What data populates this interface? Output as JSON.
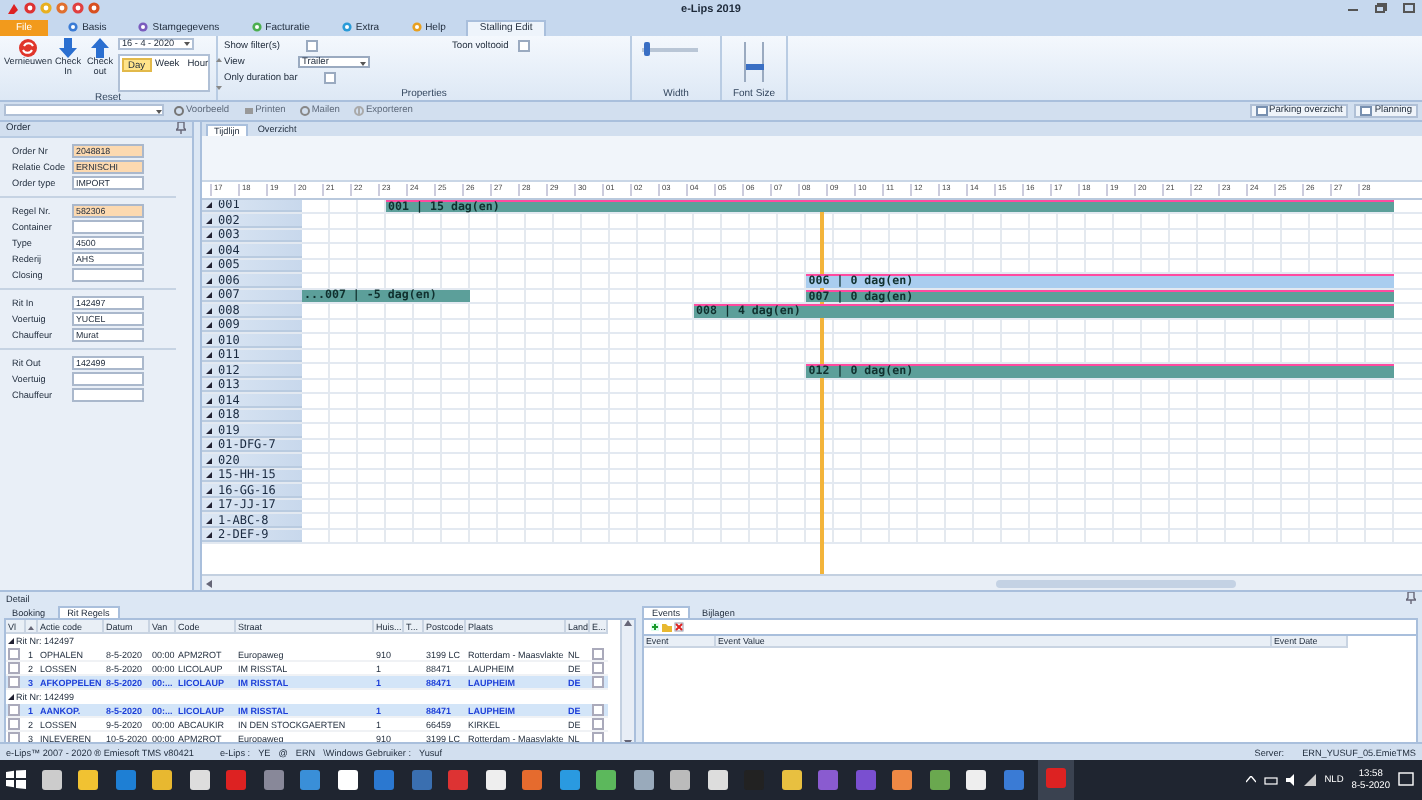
{
  "window": {
    "title": "e-Lips 2019"
  },
  "ribbon": {
    "tabs": [
      {
        "label": "File",
        "kind": "file",
        "selected": false
      },
      {
        "label": "Basis",
        "kind": "page",
        "selected": false
      },
      {
        "label": "Stamgegevens",
        "kind": "page",
        "selected": false
      },
      {
        "label": "Facturatie",
        "kind": "page",
        "selected": false
      },
      {
        "label": "Extra",
        "kind": "page",
        "selected": false
      },
      {
        "label": "Help",
        "kind": "page",
        "selected": false
      },
      {
        "label": "Stalling Edit",
        "kind": "page",
        "selected": true
      }
    ],
    "reset_group": {
      "label": "Reset",
      "buttons": [
        "Vernieuwen",
        "Check In",
        "Check out"
      ],
      "date": "16 - 4 - 2020",
      "scales": [
        {
          "label": "Day",
          "selected": true
        },
        {
          "label": "Week",
          "selected": false
        },
        {
          "label": "Hour",
          "selected": false
        }
      ]
    },
    "properties_group": {
      "label": "Properties",
      "options": [
        {
          "kind": "checkbox",
          "label": "Show filter(s)",
          "checked": false
        },
        {
          "kind": "checkbox",
          "label": "Toon voltooid",
          "checked": false
        },
        {
          "kind": "dropdown",
          "label": "View",
          "value": "Trailer"
        },
        {
          "kind": "checkbox",
          "label": "Only duration bar",
          "checked": false
        }
      ]
    },
    "width_group": {
      "label": "Width",
      "level": 0.1
    },
    "font_size_group": {
      "label": "Font Size",
      "level": 0.35
    }
  },
  "toolbar": {
    "buttons": [
      {
        "label": "Voorbeeld",
        "disabled": true
      },
      {
        "label": "Printen",
        "disabled": true
      },
      {
        "label": "Mailen",
        "disabled": true
      },
      {
        "label": "Exporteren",
        "disabled": true
      }
    ],
    "right_buttons": [
      "Parking overzicht",
      "Planning"
    ]
  },
  "order_panel": {
    "title": "Order",
    "sections": [
      {
        "fields": [
          {
            "label": "Order Nr",
            "value": "2048818",
            "highlighted": true
          },
          {
            "label": "Relatie Code",
            "value": "ERNISCHI",
            "highlighted": true
          },
          {
            "label": "Order type",
            "value": "IMPORT",
            "highlighted": false
          }
        ]
      },
      {
        "fields": [
          {
            "label": "Regel Nr.",
            "value": "582306",
            "highlighted": true
          },
          {
            "label": "Container",
            "highlighted": false
          },
          {
            "label": "Type",
            "value": "4500",
            "highlighted": false
          },
          {
            "label": "Rederij",
            "value": "AHS",
            "highlighted": false
          },
          {
            "label": "Closing",
            "highlighted": false
          }
        ]
      },
      {
        "fields": [
          {
            "label": "Rit In",
            "value": "142497",
            "highlighted": false
          },
          {
            "label": "Voertuig",
            "value": "YUCEL",
            "highlighted": false
          },
          {
            "label": "Chauffeur",
            "value": "Murat",
            "highlighted": false
          }
        ]
      },
      {
        "fields": [
          {
            "label": "Rit Out",
            "value": "142499",
            "highlighted": false
          },
          {
            "label": "Voertuig",
            "highlighted": false
          },
          {
            "label": "Chauffeur",
            "highlighted": false
          }
        ]
      }
    ]
  },
  "timeline": {
    "tabs": [
      {
        "label": "Tijdlijn",
        "selected": true
      },
      {
        "label": "Overzicht",
        "selected": false
      }
    ],
    "ticks": [
      {
        "label": "17",
        "now": false
      },
      {
        "label": "18",
        "now": false
      },
      {
        "label": "19",
        "now": false
      },
      {
        "label": "20",
        "now": false
      },
      {
        "label": "21",
        "now": false
      },
      {
        "label": "22",
        "now": false
      },
      {
        "label": "23",
        "now": false
      },
      {
        "label": "24",
        "now": false
      },
      {
        "label": "25",
        "now": false
      },
      {
        "label": "26",
        "now": false
      },
      {
        "label": "27",
        "now": false
      },
      {
        "label": "28",
        "now": false
      },
      {
        "label": "29",
        "now": false
      },
      {
        "label": "30",
        "now": false
      },
      {
        "label": "01",
        "now": false
      },
      {
        "label": "02",
        "now": false
      },
      {
        "label": "03",
        "now": false
      },
      {
        "label": "04",
        "now": false
      },
      {
        "label": "05",
        "now": false
      },
      {
        "label": "06",
        "now": false
      },
      {
        "label": "07",
        "now": false
      },
      {
        "label": "08",
        "now": true
      },
      {
        "label": "09",
        "now": false
      },
      {
        "label": "10",
        "now": false
      },
      {
        "label": "11",
        "now": false
      },
      {
        "label": "12",
        "now": false
      },
      {
        "label": "13",
        "now": false
      },
      {
        "label": "14",
        "now": false
      },
      {
        "label": "15",
        "now": false
      },
      {
        "label": "16",
        "now": false
      },
      {
        "label": "17",
        "now": false
      },
      {
        "label": "18",
        "now": false
      },
      {
        "label": "19",
        "now": false
      },
      {
        "label": "20",
        "now": false
      },
      {
        "label": "21",
        "now": false
      },
      {
        "label": "22",
        "now": false
      },
      {
        "label": "23",
        "now": false
      },
      {
        "label": "24",
        "now": false
      },
      {
        "label": "25",
        "now": false
      },
      {
        "label": "26",
        "now": false
      },
      {
        "label": "27",
        "now": false
      },
      {
        "label": "28",
        "now": false
      }
    ],
    "rows": [
      {
        "label": "001",
        "bars": [
          {
            "label": "001 | 15 dag(en)",
            "kind": "outgoing",
            "level": 0.923,
            "flagged": true,
            "selected": false
          }
        ]
      },
      {
        "label": "002"
      },
      {
        "label": "003"
      },
      {
        "label": "004"
      },
      {
        "label": "005"
      },
      {
        "label": "006",
        "bars": [
          {
            "label": "006 | 0 dag(en)",
            "kind": "outgoing",
            "level": 0.538,
            "flagged": true,
            "selected": true
          }
        ]
      },
      {
        "label": "007",
        "bars": [
          {
            "label": "...007 | -5 dag(en)",
            "kind": "incoming",
            "level": 0.154,
            "flagged": false,
            "selected": false
          },
          {
            "label": "007 | 0 dag(en)",
            "kind": "outgoing",
            "level": 0.538,
            "flagged": true,
            "selected": false
          }
        ]
      },
      {
        "label": "008",
        "bars": [
          {
            "label": "008 | 4 dag(en)",
            "kind": "outgoing",
            "level": 0.641,
            "flagged": true,
            "selected": false
          }
        ]
      },
      {
        "label": "009"
      },
      {
        "label": "010"
      },
      {
        "label": "011"
      },
      {
        "label": "012",
        "bars": [
          {
            "label": "012 | 0 dag(en)",
            "kind": "outgoing",
            "level": 0.538,
            "flagged": true,
            "selected": false
          }
        ]
      },
      {
        "label": "013"
      },
      {
        "label": "014"
      },
      {
        "label": "018"
      },
      {
        "label": "019"
      },
      {
        "label": "01-DFG-7"
      },
      {
        "label": "020"
      },
      {
        "label": "15-HH-15"
      },
      {
        "label": "16-GG-16"
      },
      {
        "label": "17-JJ-17"
      },
      {
        "label": "1-ABC-8"
      },
      {
        "label": "2-DEF-9"
      }
    ]
  },
  "detail": {
    "title": "Detail",
    "tabs": [
      {
        "label": "Booking",
        "selected": false
      },
      {
        "label": "Rit Regels",
        "selected": true
      }
    ],
    "columns": [
      "Vl",
      "Actie code",
      "Datum",
      "Van",
      "Code",
      "Straat",
      "Huis...",
      "T...",
      "Postcode",
      "Plaats",
      "Land",
      "E..."
    ],
    "groups": [
      {
        "label": "Rit Nr: 142497",
        "expanded": true,
        "rows": [
          {
            "no": "1",
            "action": "OPHALEN",
            "date": "8-5-2020",
            "from": "00:00",
            "code": "APM2ROT",
            "street": "Europaweg",
            "house": "910",
            "postcode": "3199 LC",
            "city": "Rotterdam - Maasvlakte",
            "country": "NL",
            "checked": false,
            "e_checked": false,
            "selected": false
          },
          {
            "no": "2",
            "action": "LOSSEN",
            "date": "8-5-2020",
            "from": "00:00",
            "code": "LICOLAUP",
            "street": "IM RISSTAL",
            "house": "1",
            "postcode": "88471",
            "city": "LAUPHEIM",
            "country": "DE",
            "checked": false,
            "e_checked": false,
            "selected": false
          },
          {
            "no": "3",
            "action": "AFKOPPELEN",
            "date": "8-5-2020",
            "from": "00:...",
            "code": "LICOLAUP",
            "street": "IM RISSTAL",
            "house": "1",
            "postcode": "88471",
            "city": "LAUPHEIM",
            "country": "DE",
            "checked": false,
            "e_checked": false,
            "selected": true
          }
        ]
      },
      {
        "label": "Rit Nr: 142499",
        "expanded": true,
        "rows": [
          {
            "no": "1",
            "action": "AANKOP.",
            "date": "8-5-2020",
            "from": "00:...",
            "code": "LICOLAUP",
            "street": "IM RISSTAL",
            "house": "1",
            "postcode": "88471",
            "city": "LAUPHEIM",
            "country": "DE",
            "checked": false,
            "e_checked": false,
            "selected": true
          },
          {
            "no": "2",
            "action": "LOSSEN",
            "date": "9-5-2020",
            "from": "00:00",
            "code": "ABCAUKIR",
            "street": "IN DEN STOCKGAERTEN",
            "house": "1",
            "postcode": "66459",
            "city": "KIRKEL",
            "country": "DE",
            "checked": false,
            "e_checked": false,
            "selected": false
          },
          {
            "no": "3",
            "action": "INLEVEREN",
            "date": "10-5-2020",
            "from": "00:00",
            "code": "APM2ROT",
            "street": "Europaweg",
            "house": "910",
            "postcode": "3199 LC",
            "city": "Rotterdam - Maasvlakte",
            "country": "NL",
            "checked": false,
            "e_checked": false,
            "selected": false
          }
        ]
      }
    ]
  },
  "events": {
    "tabs": [
      {
        "label": "Events",
        "selected": true
      },
      {
        "label": "Bijlagen",
        "selected": false
      }
    ],
    "columns": [
      "Event",
      "Event Value",
      "Event Date"
    ]
  },
  "status_bar": {
    "copyright": "e-Lips™ 2007 - 2020 ® Emiesoft TMS v80421",
    "session": [
      "e-Lips :",
      "YE",
      "@",
      "ERN",
      "\\Windows Gebruiker :",
      "Yusuf"
    ],
    "server_label": "Server:",
    "server": "ERN_YUSUF_05.EmieTMS"
  },
  "taskbar": {
    "language": "NLD",
    "time": "13:58",
    "date": "8-5-2020"
  }
}
